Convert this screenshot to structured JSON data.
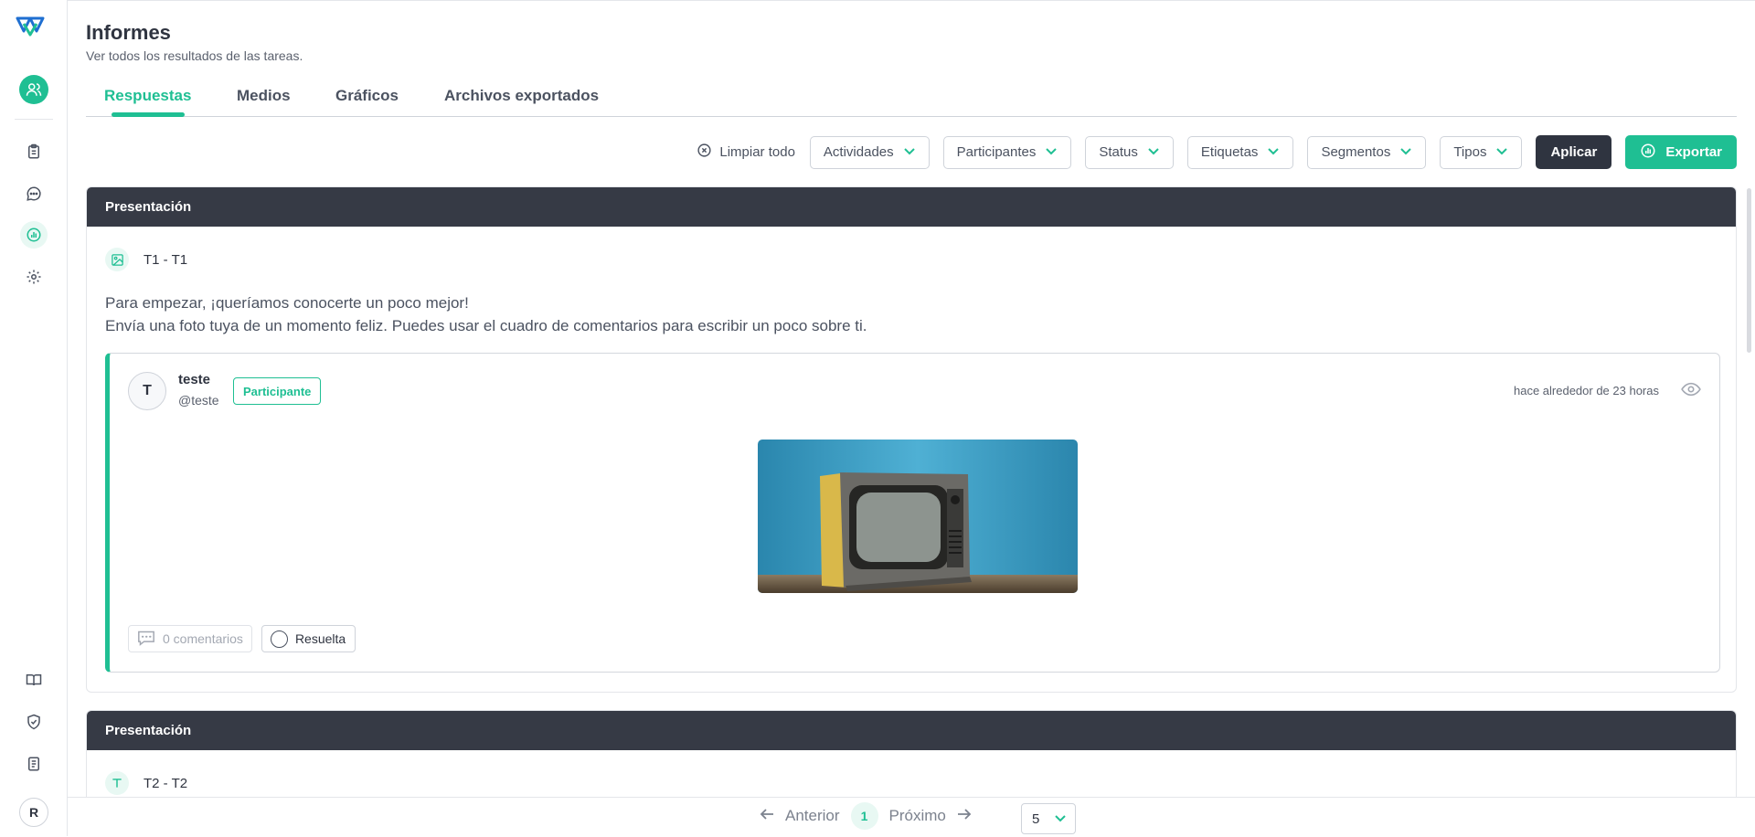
{
  "colors": {
    "accent": "#1fbf93",
    "dark": "#363a45",
    "text": "#2f3440"
  },
  "sidebar": {
    "items": [
      {
        "icon": "clipboard-icon",
        "active": false
      },
      {
        "icon": "chat-icon",
        "active": false
      },
      {
        "icon": "chart-icon",
        "active": true
      },
      {
        "icon": "gear-icon",
        "active": false
      },
      {
        "icon": "book-icon",
        "active": false
      },
      {
        "icon": "shield-check-icon",
        "active": false
      },
      {
        "icon": "document-icon",
        "active": false
      }
    ],
    "user_initial": "R"
  },
  "header": {
    "title": "Informes",
    "subtitle": "Ver todos los resultados de las tareas."
  },
  "tabs": [
    {
      "label": "Respuestas",
      "active": true
    },
    {
      "label": "Medios",
      "active": false
    },
    {
      "label": "Gráficos",
      "active": false
    },
    {
      "label": "Archivos exportados",
      "active": false
    }
  ],
  "filters": {
    "clear_all": "Limpiar todo",
    "selects": [
      "Actividades",
      "Participantes",
      "Status",
      "Etiquetas",
      "Segmentos",
      "Tipos"
    ],
    "apply": "Aplicar",
    "export": "Exportar"
  },
  "cards": [
    {
      "header": "Presentación",
      "task": "T1 - T1",
      "question_lines": [
        "Para empezar, ¡queríamos conocerte un poco mejor!",
        "Envía una foto tuya de un momento feliz. Puedes usar el cuadro de comentarios para escribir un poco sobre ti."
      ],
      "response": {
        "avatar_initial": "T",
        "name": "teste",
        "handle": "@teste",
        "badge": "Participante",
        "time": "hace alrededor de 23 horas",
        "comments": "0 comentarios",
        "resolved": "Resuelta"
      }
    },
    {
      "header": "Presentación",
      "task": "T2 - T2"
    }
  ],
  "pagination": {
    "previous": "Anterior",
    "current": "1",
    "next": "Próximo",
    "page_size": "5"
  }
}
